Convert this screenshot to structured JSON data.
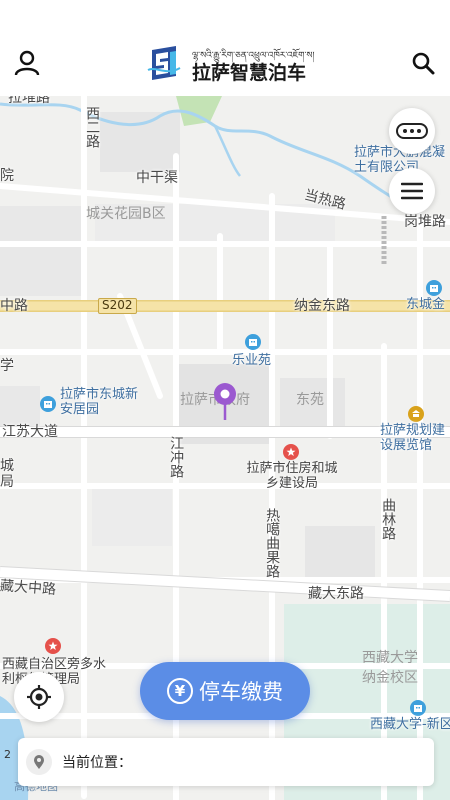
{
  "header": {
    "tibetan_subtitle": "ལྷ་སའི་རྒྱུ་རིག་ཅན་འཕྲུལ་འཁོར་འཇོག་ས།",
    "title": "拉萨智慧泊车",
    "user_icon": "user-icon",
    "search_icon": "search-icon"
  },
  "map": {
    "roads": {
      "lhaduilu": "拉堆路",
      "xiyilu": "西二路",
      "zhongganqu": "中干渠",
      "dangrelu": "当热路",
      "gangduilu": "岗堆路",
      "zhonglu": "中路",
      "s202": "S202",
      "najindonglu": "纳金东路",
      "jiangsudadao": "江苏大道",
      "jiangchonglu": "江冲路",
      "reqiaoquguolu": "热噶曲果路",
      "qulinlu": "曲林路",
      "zangdazhonglu": "藏大中路",
      "zangdadonglu": "藏大东路",
      "edge_yuan": "院",
      "edge_xue": "学",
      "edge_cheng": "城",
      "edge_ju": "局"
    },
    "areas": {
      "chengguan_huayuan": "城关花园B区",
      "lasa_zhengfu": "拉萨市政府",
      "dongyuan": "东苑",
      "xizang_daxue": "西藏大学",
      "najin_xiaoqu": "纳金校区"
    },
    "pois": {
      "dapeng": "拉萨市大鹏混凝土有限公司",
      "dongchengjin": "东城金",
      "leyeyuan": "乐业苑",
      "dongcheng_xinan": "拉萨市东城新安居园",
      "guihua": "拉萨规划建设展览馆",
      "zhufang": "拉萨市住房和城乡建设局",
      "pangduo": "西藏自治区旁多水利枢纽管理局",
      "xizang_daxue_xin": "西藏大学-新区"
    },
    "map_brand": "高德地图",
    "scale_text": "2"
  },
  "controls": {
    "more_icon": "more-icon",
    "menu_icon": "menu-icon",
    "locate_icon": "locate-icon"
  },
  "pay_button": {
    "icon": "¥",
    "label": "停车缴费"
  },
  "location_bar": {
    "label": "当前位置：",
    "value": ""
  },
  "colors": {
    "accent": "#5b8de6",
    "pin": "#9b59d0",
    "water": "#a8d4f0",
    "green": "#c4e3b5",
    "highway": "#f5e3a8"
  }
}
